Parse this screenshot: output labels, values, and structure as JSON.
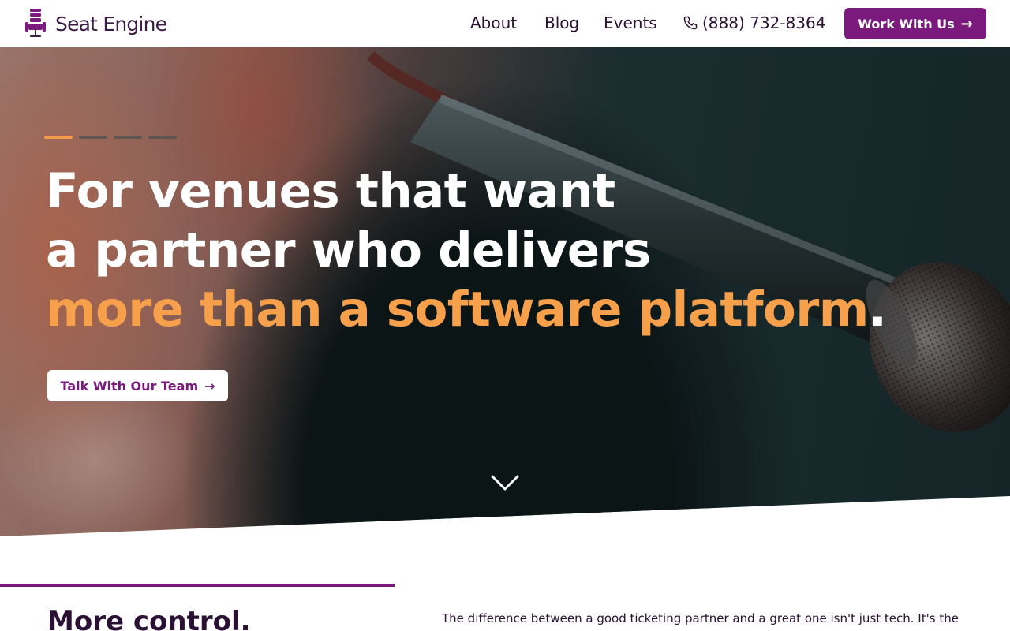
{
  "brand": {
    "name": "Seat Engine",
    "primary_color": "#7a1a7d",
    "accent_color": "#f6a04c"
  },
  "nav": {
    "items": [
      {
        "label": "About"
      },
      {
        "label": "Blog"
      },
      {
        "label": "Events"
      }
    ],
    "phone": "(888) 732-8364",
    "phone_icon": "phone-icon",
    "cta_label": "Work With Us",
    "cta_arrow": "→"
  },
  "hero": {
    "slides_total": 4,
    "active_slide": 1,
    "headline_line1": "For venues that want",
    "headline_line2": "a partner who delivers",
    "headline_line3_orange": "more than a software platform",
    "headline_line3_end": ".",
    "button_label": "Talk With Our Team",
    "button_arrow": "→",
    "scroll_icon": "chevron-down-icon"
  },
  "section": {
    "title": "More control.",
    "body": "The difference between a good ticketing partner and a great one isn't just tech. It's the"
  }
}
